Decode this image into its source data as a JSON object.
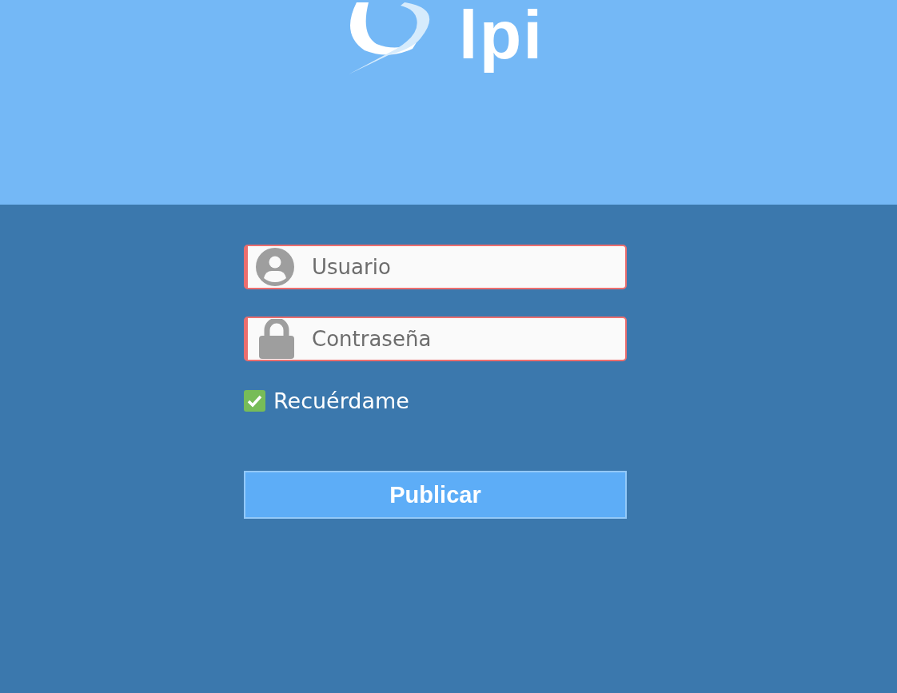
{
  "logo": {
    "text": "lpi"
  },
  "fields": [
    {
      "kind": "user",
      "placeholder": "Usuario",
      "invalid": true
    },
    {
      "kind": "password",
      "placeholder": "Contraseña",
      "invalid": true
    }
  ],
  "remember": {
    "label": "Recuérdame",
    "checked": true
  },
  "submit": {
    "label": "Publicar"
  }
}
